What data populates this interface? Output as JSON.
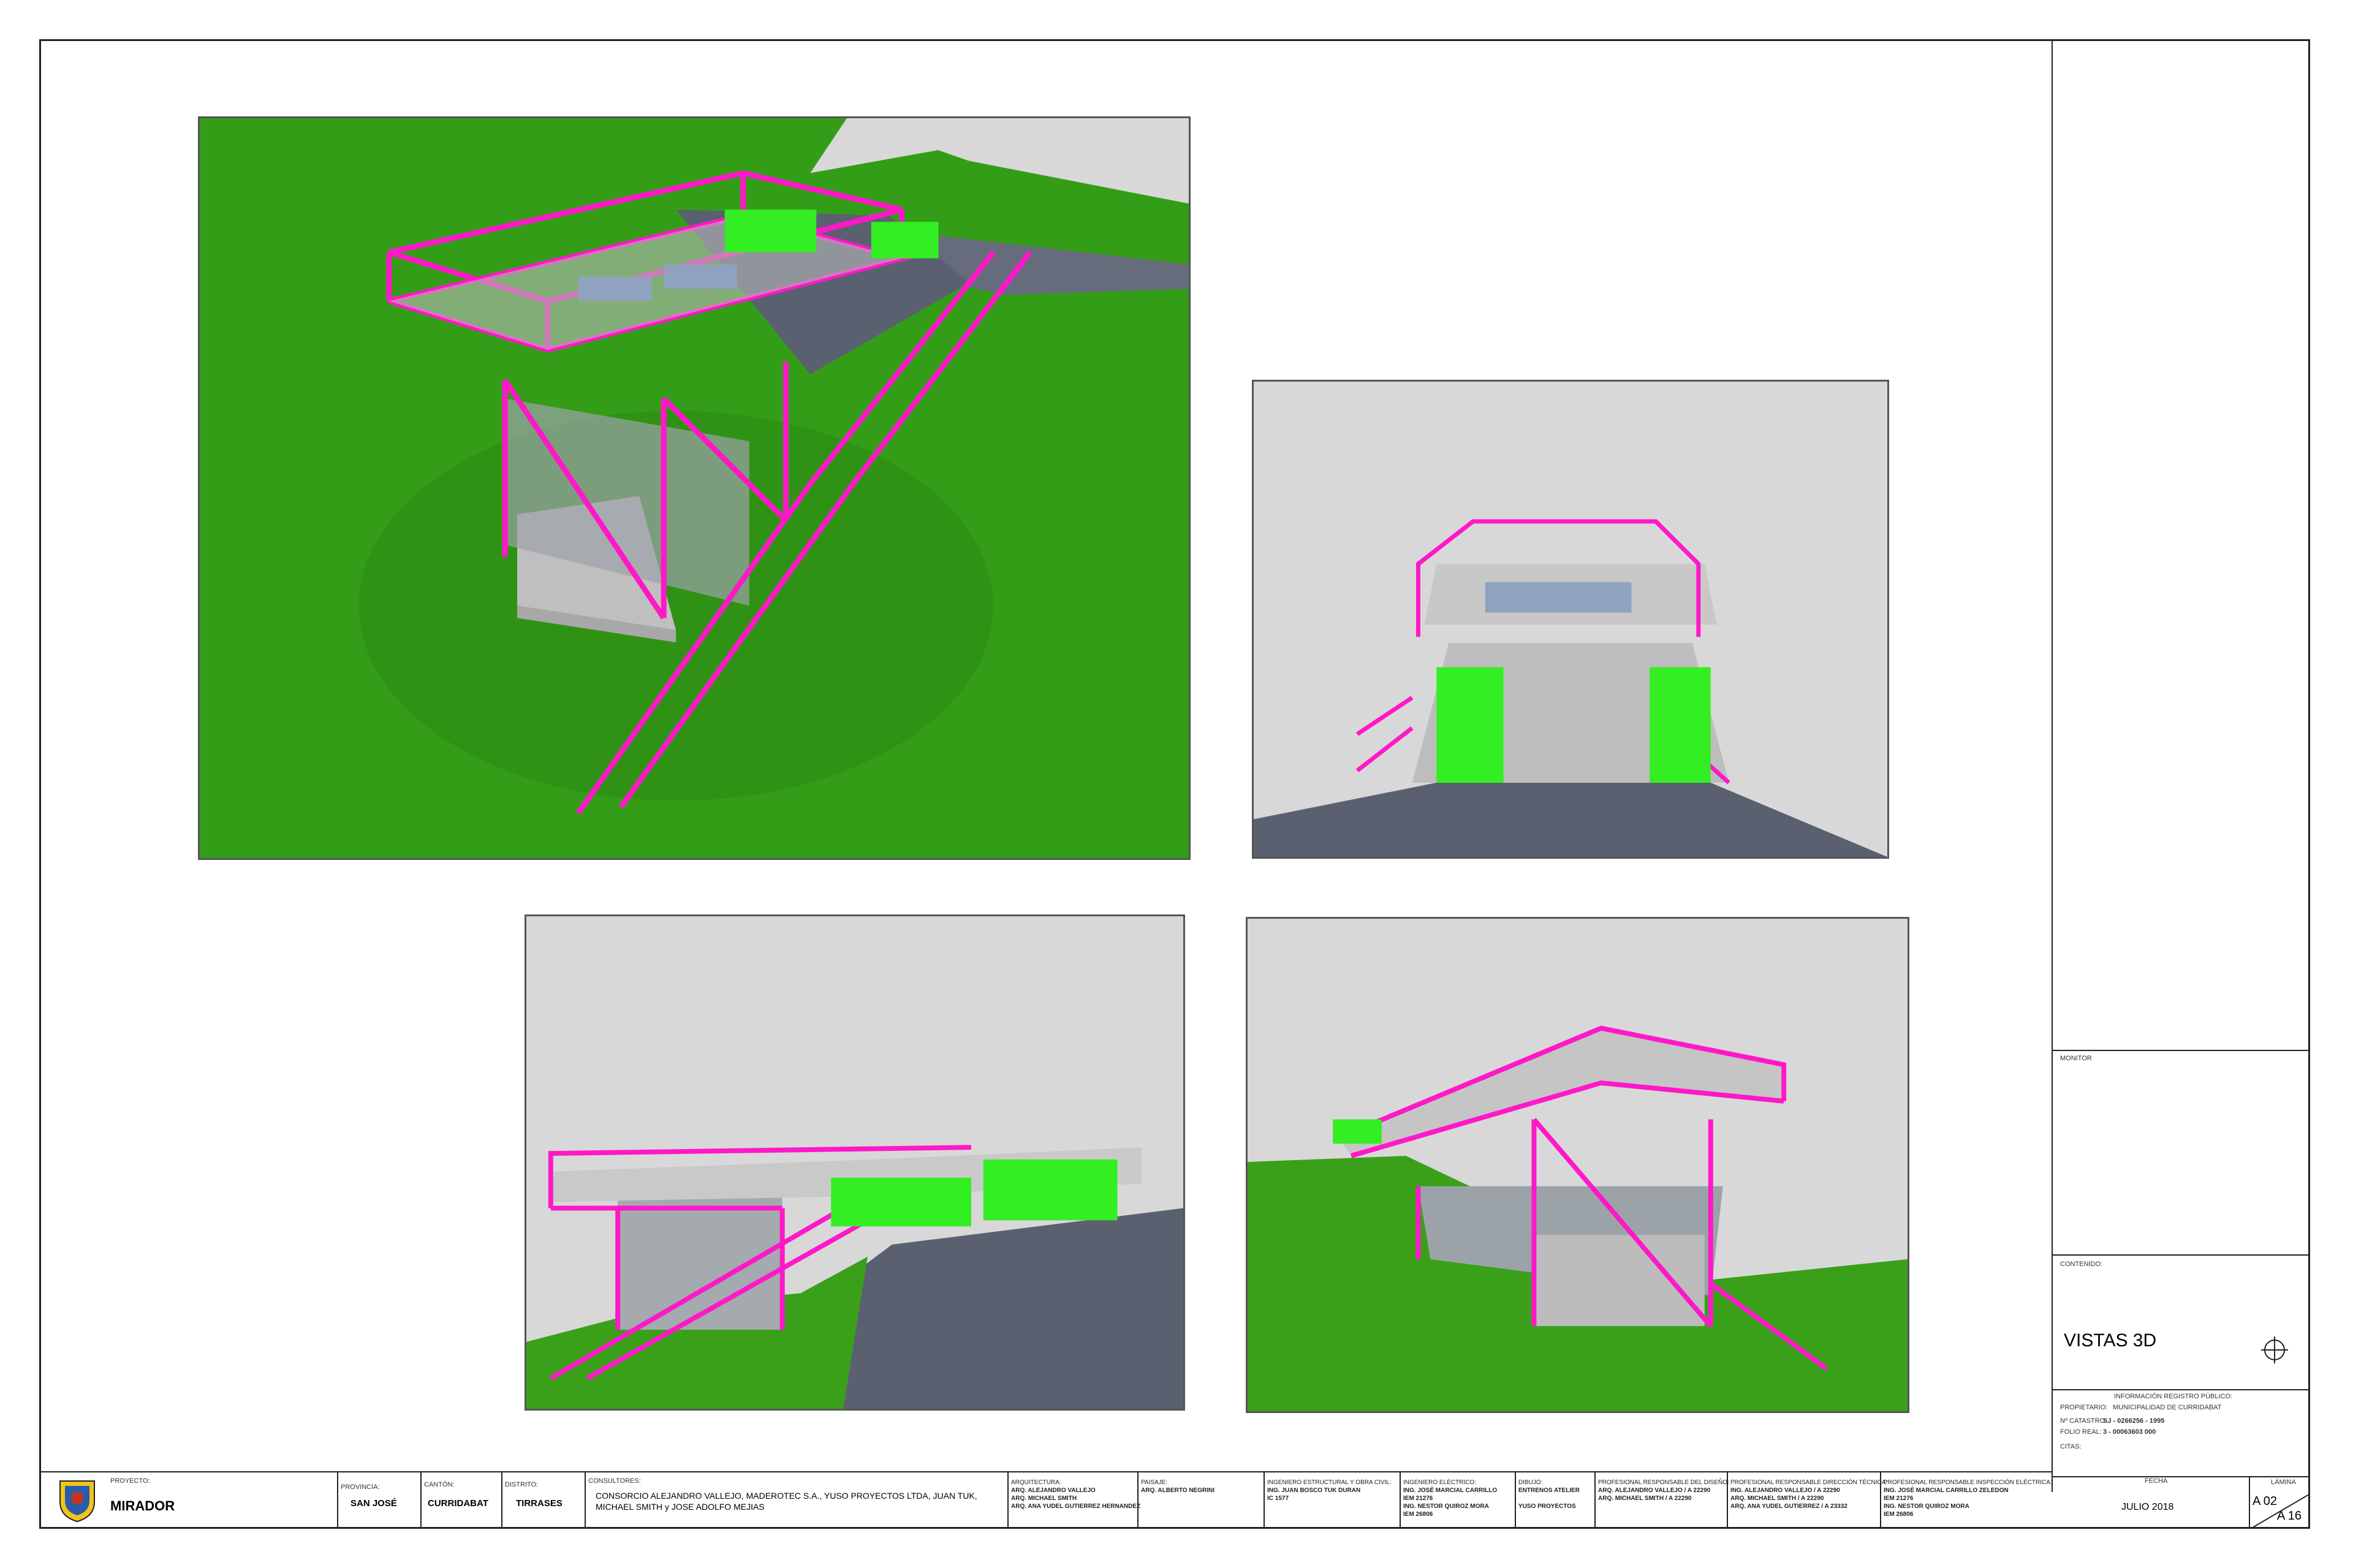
{
  "views": [
    {
      "name": "isometric-view"
    },
    {
      "name": "front-view"
    },
    {
      "name": "left-view"
    },
    {
      "name": "right-view"
    }
  ],
  "colors": {
    "steel": "#ff18c8",
    "container": "#33ee22",
    "grass": "#3aa01a",
    "sky": "#d8d8d8",
    "pavement": "#5a6070"
  },
  "side_panel": {
    "monitor_label": "MONITOR",
    "contenido_label": "CONTENIDO:",
    "contenido_value": "VISTAS 3D",
    "registro_title": "INFORMACIÓN REGISTRO PÚBLICO:",
    "propietario_label": "PROPIETARIO:",
    "propietario_value": "MUNICIPALIDAD DE CURRIDABAT",
    "catastro_label": "Nº CATASTRO:",
    "catastro_value": "SJ - 0266256 - 1995",
    "folio_label": "FOLIO REAL:",
    "folio_value": "3 - 00063603 000",
    "citas_label": "CITAS:",
    "fecha_label": "FECHA",
    "fecha_value": "JULIO 2018",
    "lamina_label": "LÁMINA",
    "lamina_num": "A 02",
    "lamina_total": "A 16"
  },
  "title_block": {
    "proyecto_label": "PROYECTO:",
    "proyecto_value": "MIRADOR",
    "provincia_label": "PROVINCIA:",
    "provincia_value": "SAN JOSÉ",
    "canton_label": "CANTÓN:",
    "canton_value": "CURRIDABAT",
    "distrito_label": "DISTRITO:",
    "distrito_value": "TIRRASES",
    "consultores_label": "CONSULTORES:",
    "consultores_line1": "CONSORCIO ALEJANDRO VALLEJO, MADEROTEC S.A., YUSO PROYECTOS LTDA, JUAN TUK,",
    "consultores_line2": "MICHAEL SMITH y JOSE ADOLFO MEJIAS",
    "arquitectura_label": "ARQUITECTURA:",
    "arquitectura_1": "ARQ. ALEJANDRO VALLEJO",
    "arquitectura_2": "ARQ. MICHAEL SMITH",
    "arquitectura_3": "ARQ. ANA YUDEL GUTIERREZ HERNANDEZ",
    "paisaje_label": "PAISAJE:",
    "paisaje_1": "ARQ. ALBERTO NEGRINI",
    "estructural_label": "INGENIERO ESTRUCTURAL Y OBRA CIVIL:",
    "estructural_1": "ING. JUAN BOSCO TUK DURAN",
    "estructural_2": "IC 1577",
    "electrico_label": "INGENIERO ELÉCTRICO:",
    "electrico_1": "ING. JOSÉ MARCIAL CARRILLO",
    "electrico_2": "IEM 21276",
    "electrico_3": "ING. NESTOR QUIROZ MORA",
    "electrico_4": "IEM 26806",
    "dibujo_label": "DIBUJO:",
    "dibujo_1": "ENTRENOS ATELIER",
    "dibujo_2": "YUSO PROYECTOS",
    "diseno_label": "PROFESIONAL RESPONSABLE DEL DISEÑO:",
    "diseno_1": "ARQ. ALEJANDRO VALLEJO / A 22290",
    "diseno_2": "ARQ. MICHAEL SMITH / A 22290",
    "direccion_label": "PROFESIONAL RESPONSABLE DIRECCIÓN TÉCNICA:",
    "direccion_1": "ING. ALEJANDRO VALLEJO / A 22290",
    "direccion_2": "ARQ. MICHAEL SMITH / A 22290",
    "direccion_3": "ARQ. ANA YUDEL GUTIERREZ / A 23332",
    "inspeccion_label": "PROFESIONAL RESPONSABLE INSPECCIÓN ELÉCTRICA:",
    "inspeccion_1": "ING. JOSÉ MARCIAL CARRILLO ZELEDON",
    "inspeccion_2": "IEM 21276",
    "inspeccion_3": "ING. NESTOR QUIROZ MORA",
    "inspeccion_4": "IEM 26806"
  }
}
